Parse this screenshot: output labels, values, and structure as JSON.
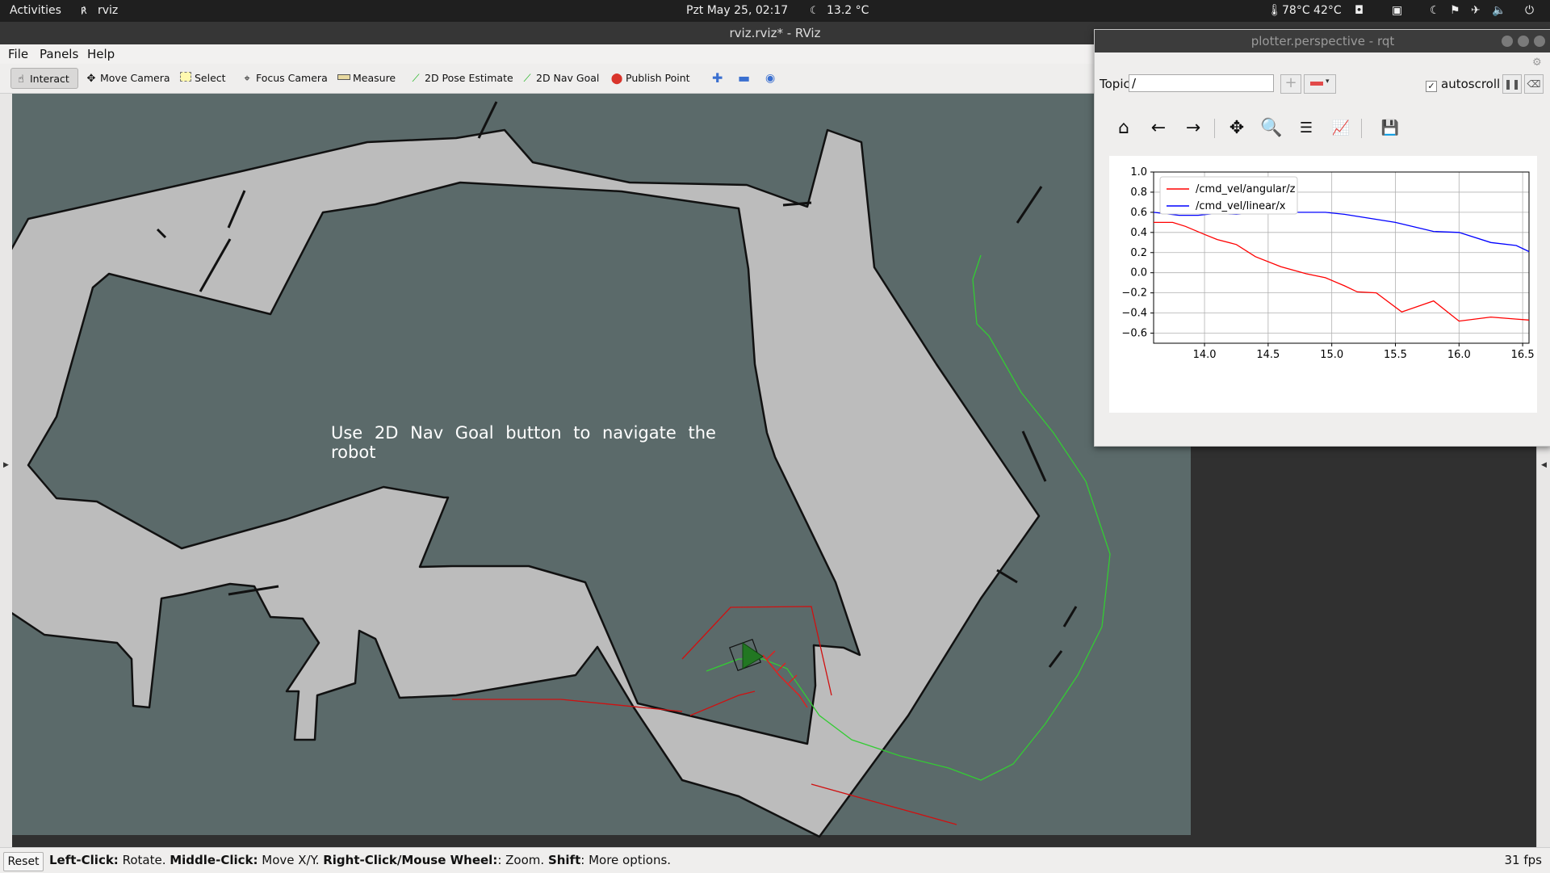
{
  "topbar": {
    "activities": "Activities",
    "app_name": "rviz",
    "clock": "Pzt May 25, 02:17",
    "weather": "13.2 °C",
    "temps": "78°C 42°C"
  },
  "rviz": {
    "window_title": "rviz.rviz* - RViz",
    "menu": [
      "File",
      "Panels",
      "Help"
    ],
    "tools": [
      {
        "label": "Interact",
        "icon": "hand-icon"
      },
      {
        "label": "Move Camera",
        "icon": "move-camera-icon"
      },
      {
        "label": "Select",
        "icon": "select-icon"
      },
      {
        "label": "Focus Camera",
        "icon": "focus-camera-icon"
      },
      {
        "label": "Measure",
        "icon": "measure-icon"
      },
      {
        "label": "2D Pose Estimate",
        "icon": "green-arrow-icon"
      },
      {
        "label": "2D Nav Goal",
        "icon": "green-arrow-icon"
      },
      {
        "label": "Publish Point",
        "icon": "map-pin-icon"
      }
    ],
    "overlay_text": "Use 2D Nav Goal button to navigate the robot",
    "status": {
      "reset_label": "Reset",
      "hint_parts": [
        {
          "bold": "Left-Click:",
          "text": " Rotate. "
        },
        {
          "bold": "Middle-Click:",
          "text": " Move X/Y. "
        },
        {
          "bold": "Right-Click/Mouse Wheel:",
          "text": ": Zoom. "
        },
        {
          "bold": "Shift",
          "text": ": More options."
        }
      ],
      "fps": "31 fps"
    }
  },
  "rqt": {
    "window_title": "plotter.perspective - rqt",
    "topic_label": "Topic",
    "topic_value": "/",
    "autoscroll_label": "autoscroll",
    "autoscroll_checked": true,
    "toolbar_icons": [
      "home-icon",
      "back-icon",
      "forward-icon",
      "pan-icon",
      "zoom-icon",
      "configure-icon",
      "edit-curves-icon",
      "save-icon"
    ]
  },
  "chart_data": {
    "type": "line",
    "title": "",
    "xlabel": "",
    "ylabel": "",
    "xlim": [
      13.6,
      16.55
    ],
    "ylim": [
      -0.7,
      1.0
    ],
    "xticks": [
      "14.0",
      "14.5",
      "15.0",
      "15.5",
      "16.0",
      "16.5"
    ],
    "yticks": [
      "1.0",
      "0.8",
      "0.6",
      "0.4",
      "0.2",
      "0.0",
      "−0.2",
      "−0.4",
      "−0.6"
    ],
    "grid": true,
    "legend_position": "top-left",
    "series": [
      {
        "name": "/cmd_vel/angular/z",
        "color": "#ff0000",
        "x": [
          13.6,
          13.75,
          13.85,
          14.0,
          14.1,
          14.25,
          14.4,
          14.6,
          14.8,
          14.95,
          15.1,
          15.2,
          15.35,
          15.55,
          15.8,
          16.0,
          16.25,
          16.45,
          16.55
        ],
        "y": [
          0.5,
          0.5,
          0.46,
          0.38,
          0.33,
          0.28,
          0.16,
          0.06,
          -0.01,
          -0.05,
          -0.13,
          -0.19,
          -0.2,
          -0.39,
          -0.28,
          -0.48,
          -0.44,
          -0.46,
          -0.47
        ]
      },
      {
        "name": "/cmd_vel/linear/x",
        "color": "#0000ff",
        "x": [
          13.6,
          13.8,
          13.95,
          14.1,
          14.25,
          14.45,
          14.6,
          14.85,
          14.95,
          15.1,
          15.3,
          15.5,
          15.8,
          16.0,
          16.25,
          16.45,
          16.55
        ],
        "y": [
          0.6,
          0.57,
          0.57,
          0.59,
          0.58,
          0.6,
          0.6,
          0.6,
          0.6,
          0.58,
          0.54,
          0.5,
          0.41,
          0.4,
          0.3,
          0.27,
          0.21
        ]
      }
    ]
  }
}
